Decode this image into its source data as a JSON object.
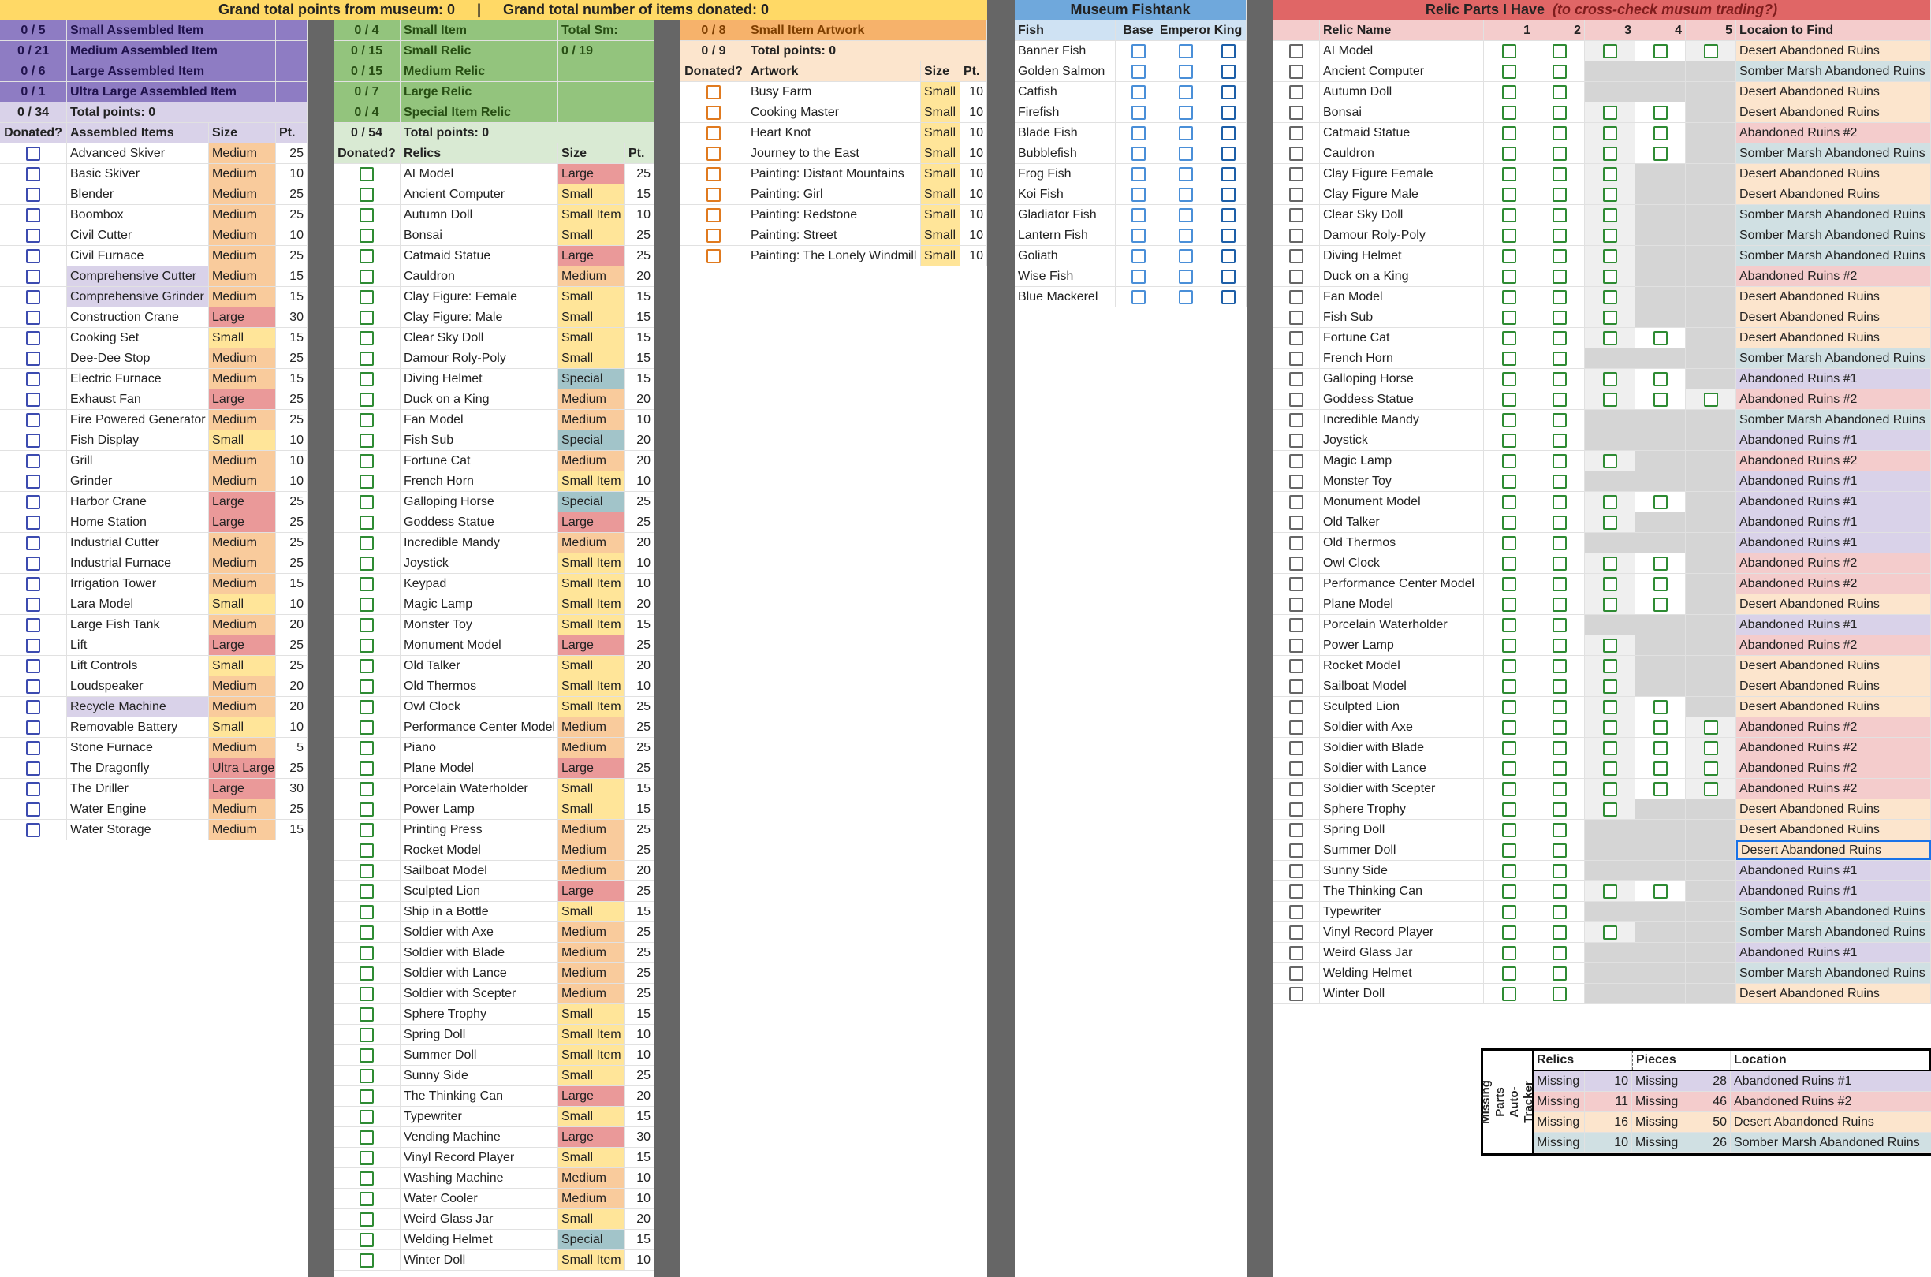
{
  "banner": {
    "points": "Grand total points from museum: 0",
    "sep": "|",
    "items": "Grand total number of items donated: 0"
  },
  "colors": {
    "purple_dark": "#8e7cc3",
    "purple_light": "#d9d2e9",
    "green_dark": "#93c47d",
    "green_light": "#d9ead3",
    "orange_dark": "#f6b26b",
    "orange_light": "#fce5cd",
    "blue_head": "#6fa8dc",
    "blue_light": "#cfe2f3",
    "red_head": "#e06666",
    "red_light": "#f4cccc",
    "size_medium": "#f9cb9c",
    "size_small": "#ffe599",
    "size_large": "#ea9999",
    "size_special": "#a2c4c9",
    "size_ultra": "#ea9999",
    "loc_desert": "#fce5cd",
    "loc_somber": "#d0e0e3",
    "loc_ar1": "#d9d2e9",
    "loc_ar2": "#f4cccc"
  },
  "assembled": {
    "summary": [
      [
        "0 / 5",
        "Small Assembled Item"
      ],
      [
        "0 / 21",
        "Medium Assembled Item"
      ],
      [
        "0 / 6",
        "Large Assembled Item"
      ],
      [
        "0 / 1",
        "Ultra Large Assembled Item"
      ]
    ],
    "total": [
      "0 / 34",
      "Total points: 0"
    ],
    "header": [
      "Donated?",
      "Assembled Items",
      "Size",
      "Pt."
    ],
    "items": [
      [
        "Advanced Skiver",
        "Medium",
        "25",
        ""
      ],
      [
        "Basic Skiver",
        "Medium",
        "10",
        ""
      ],
      [
        "Blender",
        "Medium",
        "25",
        ""
      ],
      [
        "Boombox",
        "Medium",
        "25",
        ""
      ],
      [
        "Civil Cutter",
        "Medium",
        "10",
        ""
      ],
      [
        "Civil Furnace",
        "Medium",
        "25",
        ""
      ],
      [
        "Comprehensive Cutter",
        "Medium",
        "15",
        "hl"
      ],
      [
        "Comprehensive Grinder",
        "Medium",
        "15",
        "hl"
      ],
      [
        "Construction Crane",
        "Large",
        "30",
        ""
      ],
      [
        "Cooking Set",
        "Small",
        "15",
        ""
      ],
      [
        "Dee-Dee Stop",
        "Medium",
        "25",
        ""
      ],
      [
        "Electric Furnace",
        "Medium",
        "15",
        ""
      ],
      [
        "Exhaust Fan",
        "Large",
        "25",
        ""
      ],
      [
        "Fire Powered Generator",
        "Medium",
        "25",
        ""
      ],
      [
        "Fish Display",
        "Small",
        "10",
        ""
      ],
      [
        "Grill",
        "Medium",
        "10",
        ""
      ],
      [
        "Grinder",
        "Medium",
        "10",
        ""
      ],
      [
        "Harbor Crane",
        "Large",
        "25",
        ""
      ],
      [
        "Home Station",
        "Large",
        "25",
        ""
      ],
      [
        "Industrial Cutter",
        "Medium",
        "25",
        ""
      ],
      [
        "Industrial Furnace",
        "Medium",
        "25",
        ""
      ],
      [
        "Irrigation Tower",
        "Medium",
        "15",
        ""
      ],
      [
        "Lara Model",
        "Small",
        "10",
        ""
      ],
      [
        "Large Fish Tank",
        "Medium",
        "20",
        ""
      ],
      [
        "Lift",
        "Large",
        "25",
        ""
      ],
      [
        "Lift Controls",
        "Small",
        "25",
        ""
      ],
      [
        "Loudspeaker",
        "Medium",
        "20",
        ""
      ],
      [
        "Recycle Machine",
        "Medium",
        "20",
        "hl"
      ],
      [
        "Removable Battery",
        "Small",
        "10",
        ""
      ],
      [
        "Stone Furnace",
        "Medium",
        "5",
        ""
      ],
      [
        "The Dragonfly",
        "Ultra Large",
        "25",
        ""
      ],
      [
        "The Driller",
        "Large",
        "30",
        ""
      ],
      [
        "Water Engine",
        "Medium",
        "25",
        ""
      ],
      [
        "Water Storage",
        "Medium",
        "15",
        ""
      ]
    ]
  },
  "relics": {
    "summary": [
      [
        "0 / 4",
        "Small Item",
        "Total Sm:"
      ],
      [
        "0 / 15",
        "Small Relic",
        "0 / 19"
      ],
      [
        "0 / 15",
        "Medium Relic",
        ""
      ],
      [
        "0 / 7",
        "Large Relic",
        ""
      ],
      [
        "0 / 4",
        "Special Item Relic",
        ""
      ]
    ],
    "total": [
      "0 / 54",
      "Total points: 0"
    ],
    "header": [
      "Donated?",
      "Relics",
      "Size",
      "Pt."
    ],
    "items": [
      [
        "AI Model",
        "Large",
        "25"
      ],
      [
        "Ancient Computer",
        "Small",
        "15"
      ],
      [
        "Autumn Doll",
        "Small Item",
        "10"
      ],
      [
        "Bonsai",
        "Small",
        "25"
      ],
      [
        "Catmaid Statue",
        "Large",
        "25"
      ],
      [
        "Cauldron",
        "Medium",
        "20"
      ],
      [
        "Clay Figure: Female",
        "Small",
        "15"
      ],
      [
        "Clay Figure: Male",
        "Small",
        "15"
      ],
      [
        "Clear Sky Doll",
        "Small",
        "15"
      ],
      [
        "Damour Roly-Poly",
        "Small",
        "15"
      ],
      [
        "Diving Helmet",
        "Special",
        "15"
      ],
      [
        "Duck on a King",
        "Medium",
        "20"
      ],
      [
        "Fan Model",
        "Medium",
        "10"
      ],
      [
        "Fish Sub",
        "Special",
        "20"
      ],
      [
        "Fortune Cat",
        "Medium",
        "20"
      ],
      [
        "French Horn",
        "Small Item",
        "10"
      ],
      [
        "Galloping Horse",
        "Special",
        "25"
      ],
      [
        "Goddess Statue",
        "Large",
        "25"
      ],
      [
        "Incredible Mandy",
        "Medium",
        "20"
      ],
      [
        "Joystick",
        "Small Item",
        "10"
      ],
      [
        "Keypad",
        "Small Item",
        "10"
      ],
      [
        "Magic Lamp",
        "Small Item",
        "20"
      ],
      [
        "Monster Toy",
        "Small Item",
        "15"
      ],
      [
        "Monument Model",
        "Large",
        "25"
      ],
      [
        "Old Talker",
        "Small",
        "20"
      ],
      [
        "Old Thermos",
        "Small Item",
        "10"
      ],
      [
        "Owl Clock",
        "Small Item",
        "25"
      ],
      [
        "Performance Center Model",
        "Medium",
        "25"
      ],
      [
        "Piano",
        "Medium",
        "25"
      ],
      [
        "Plane Model",
        "Large",
        "25"
      ],
      [
        "Porcelain Waterholder",
        "Small",
        "15"
      ],
      [
        "Power Lamp",
        "Small",
        "15"
      ],
      [
        "Printing Press",
        "Medium",
        "25"
      ],
      [
        "Rocket Model",
        "Medium",
        "25"
      ],
      [
        "Sailboat Model",
        "Medium",
        "20"
      ],
      [
        "Sculpted Lion",
        "Large",
        "25"
      ],
      [
        "Ship in a Bottle",
        "Small",
        "15"
      ],
      [
        "Soldier with Axe",
        "Medium",
        "25"
      ],
      [
        "Soldier with Blade",
        "Medium",
        "25"
      ],
      [
        "Soldier with Lance",
        "Medium",
        "25"
      ],
      [
        "Soldier with Scepter",
        "Medium",
        "25"
      ],
      [
        "Sphere Trophy",
        "Small",
        "15"
      ],
      [
        "Spring Doll",
        "Small Item",
        "10"
      ],
      [
        "Summer Doll",
        "Small Item",
        "10"
      ],
      [
        "Sunny Side",
        "Small",
        "25"
      ],
      [
        "The Thinking Can",
        "Large",
        "20"
      ],
      [
        "Typewriter",
        "Small",
        "15"
      ],
      [
        "Vending Machine",
        "Large",
        "30"
      ],
      [
        "Vinyl Record Player",
        "Small",
        "15"
      ],
      [
        "Washing Machine",
        "Medium",
        "10"
      ],
      [
        "Water Cooler",
        "Medium",
        "10"
      ],
      [
        "Weird Glass Jar",
        "Small",
        "20"
      ],
      [
        "Welding Helmet",
        "Special",
        "15"
      ],
      [
        "Winter Doll",
        "Small Item",
        "10"
      ]
    ]
  },
  "artwork": {
    "summary": [
      "0 / 8",
      "Small Item Artwork"
    ],
    "total": [
      "0 / 9",
      "Total points: 0"
    ],
    "header": [
      "Donated?",
      "Artwork",
      "Size",
      "Pt."
    ],
    "items": [
      [
        "Busy Farm",
        "Small",
        "10"
      ],
      [
        "Cooking Master",
        "Small",
        "10"
      ],
      [
        "Heart Knot",
        "Small",
        "10"
      ],
      [
        "Journey to the East",
        "Small",
        "10"
      ],
      [
        "Painting: Distant Mountains",
        "Small",
        "10"
      ],
      [
        "Painting: Girl",
        "Small",
        "10"
      ],
      [
        "Painting: Redstone",
        "Small",
        "10"
      ],
      [
        "Painting: Street",
        "Small",
        "10"
      ],
      [
        "Painting: The Lonely Windmill",
        "Small",
        "10"
      ]
    ]
  },
  "fish": {
    "title": "Museum Fishtank",
    "header": [
      "Fish",
      "Base",
      "Emperor",
      "King"
    ],
    "items": [
      "Banner Fish",
      "Golden Salmon",
      "Catfish",
      "Firefish",
      "Blade Fish",
      "Bubblefish",
      "Frog Fish",
      "Koi Fish",
      "Gladiator Fish",
      "Lantern Fish",
      "Goliath",
      "Wise Fish",
      "Blue Mackerel"
    ]
  },
  "parts": {
    "title": "Relic Parts I Have",
    "subtitle": "(to cross-check musum trading?)",
    "header": [
      "Relic Name",
      "1",
      "2",
      "3",
      "4",
      "5",
      "Locaion to Find"
    ],
    "items": [
      [
        "AI Model",
        5,
        "Desert Abandoned Ruins"
      ],
      [
        "Ancient Computer",
        2,
        "Somber Marsh Abandoned Ruins"
      ],
      [
        "Autumn Doll",
        2,
        "Desert Abandoned Ruins"
      ],
      [
        "Bonsai",
        4,
        "Desert Abandoned Ruins"
      ],
      [
        "Catmaid Statue",
        4,
        "Abandoned Ruins #2"
      ],
      [
        "Cauldron",
        4,
        "Somber Marsh Abandoned Ruins"
      ],
      [
        "Clay Figure Female",
        3,
        "Desert Abandoned Ruins"
      ],
      [
        "Clay Figure Male",
        3,
        "Desert Abandoned Ruins"
      ],
      [
        "Clear Sky Doll",
        3,
        "Somber Marsh Abandoned Ruins"
      ],
      [
        "Damour Roly-Poly",
        3,
        "Somber Marsh Abandoned Ruins"
      ],
      [
        "Diving Helmet",
        3,
        "Somber Marsh Abandoned Ruins"
      ],
      [
        "Duck on a King",
        3,
        "Abandoned Ruins #2"
      ],
      [
        "Fan Model",
        3,
        "Desert Abandoned Ruins"
      ],
      [
        "Fish Sub",
        3,
        "Desert Abandoned Ruins"
      ],
      [
        "Fortune Cat",
        4,
        "Desert Abandoned Ruins"
      ],
      [
        "French Horn",
        2,
        "Somber Marsh Abandoned Ruins"
      ],
      [
        "Galloping Horse",
        4,
        "Abandoned Ruins #1"
      ],
      [
        "Goddess Statue",
        5,
        "Abandoned Ruins #2"
      ],
      [
        "Incredible Mandy",
        2,
        "Somber Marsh Abandoned Ruins"
      ],
      [
        "Joystick",
        2,
        "Abandoned Ruins #1"
      ],
      [
        "Magic Lamp",
        3,
        "Abandoned Ruins #2"
      ],
      [
        "Monster Toy",
        2,
        "Abandoned Ruins #1"
      ],
      [
        "Monument Model",
        4,
        "Abandoned Ruins #1"
      ],
      [
        "Old Talker",
        3,
        "Abandoned Ruins #1"
      ],
      [
        "Old Thermos",
        2,
        "Abandoned Ruins #1"
      ],
      [
        "Owl Clock",
        4,
        "Abandoned Ruins #2"
      ],
      [
        "Performance Center Model",
        4,
        "Abandoned Ruins #2"
      ],
      [
        "Plane Model",
        4,
        "Desert Abandoned Ruins"
      ],
      [
        "Porcelain Waterholder",
        2,
        "Abandoned Ruins #1"
      ],
      [
        "Power Lamp",
        3,
        "Abandoned Ruins #2"
      ],
      [
        "Rocket Model",
        3,
        "Desert Abandoned Ruins"
      ],
      [
        "Sailboat Model",
        3,
        "Desert Abandoned Ruins"
      ],
      [
        "Sculpted Lion",
        4,
        "Desert Abandoned Ruins"
      ],
      [
        "Soldier with Axe",
        5,
        "Abandoned Ruins #2"
      ],
      [
        "Soldier with Blade",
        5,
        "Abandoned Ruins #2"
      ],
      [
        "Soldier with Lance",
        5,
        "Abandoned Ruins #2"
      ],
      [
        "Soldier with Scepter",
        5,
        "Abandoned Ruins #2"
      ],
      [
        "Sphere Trophy",
        3,
        "Desert Abandoned Ruins"
      ],
      [
        "Spring Doll",
        2,
        "Desert Abandoned Ruins"
      ],
      [
        "Summer Doll",
        2,
        "Desert Abandoned Ruins"
      ],
      [
        "Sunny Side",
        2,
        "Abandoned Ruins #1"
      ],
      [
        "The Thinking Can",
        4,
        "Abandoned Ruins #1"
      ],
      [
        "Typewriter",
        2,
        "Somber Marsh Abandoned Ruins"
      ],
      [
        "Vinyl Record Player",
        3,
        "Somber Marsh Abandoned Ruins"
      ],
      [
        "Weird Glass Jar",
        2,
        "Abandoned Ruins #1"
      ],
      [
        "Welding Helmet",
        2,
        "Somber Marsh Abandoned Ruins"
      ],
      [
        "Winter Doll",
        2,
        "Desert Abandoned Ruins"
      ]
    ]
  },
  "tracker": {
    "label": "Missing Parts Auto-Tracker",
    "header": [
      "Relics",
      "Pieces",
      "Location"
    ],
    "rows": [
      [
        "Missing",
        "10",
        "Missing",
        "28",
        "Abandoned Ruins #1"
      ],
      [
        "Missing",
        "11",
        "Missing",
        "46",
        "Abandoned Ruins #2"
      ],
      [
        "Missing",
        "16",
        "Missing",
        "50",
        "Desert Abandoned Ruins"
      ],
      [
        "Missing",
        "10",
        "Missing",
        "26",
        "Somber Marsh Abandoned Ruins"
      ]
    ]
  }
}
